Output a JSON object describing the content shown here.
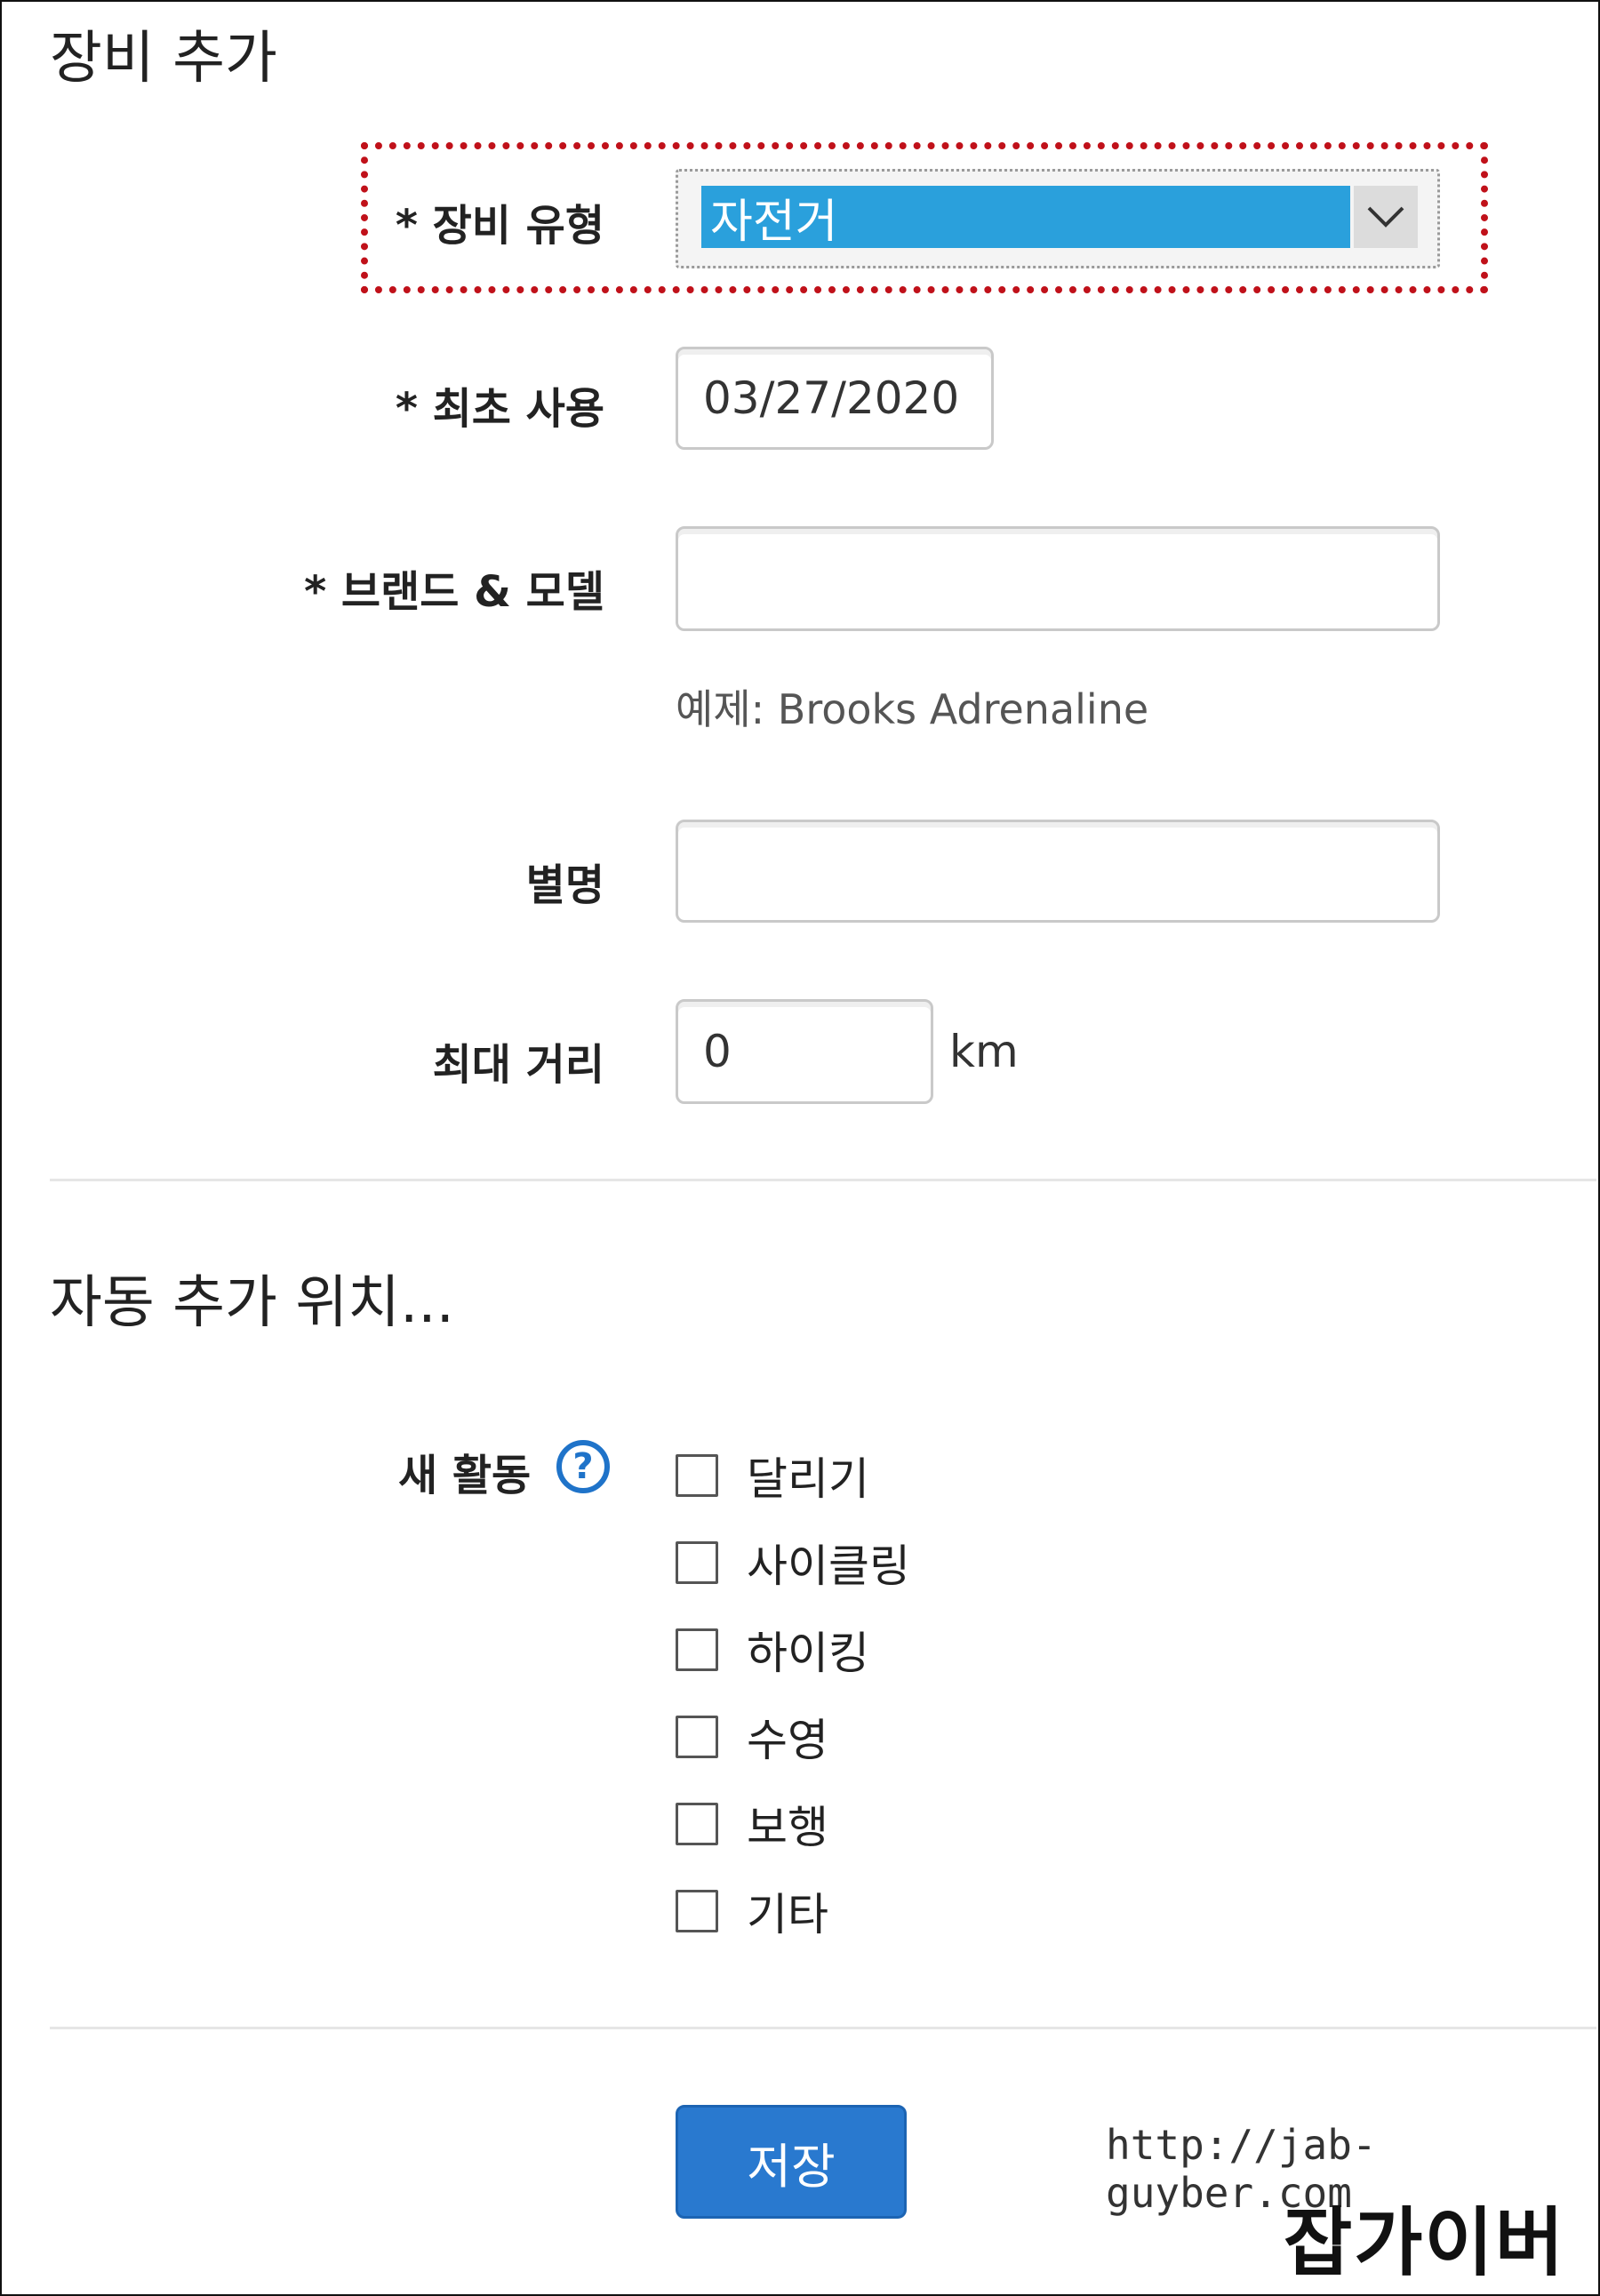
{
  "equipment": {
    "title": "장비 추가",
    "type_label": "* 장비 유형",
    "type_value": "자전거",
    "first_use_label": "* 최초 사용",
    "first_use_value": "03/27/2020",
    "brand_label": "* 브랜드 & 모델",
    "brand_value": "",
    "brand_hint": "예제: Brooks Adrenaline",
    "nickname_label": "별명",
    "nickname_value": "",
    "max_distance_label": "최대 거리",
    "max_distance_value": "0",
    "max_distance_unit": "km"
  },
  "auto_add": {
    "title": "자동 추가 위치...",
    "new_activity_label": "새 활동",
    "help_icon": "question-circle-icon",
    "options": [
      {
        "label": "달리기",
        "checked": false
      },
      {
        "label": "사이클링",
        "checked": false
      },
      {
        "label": "하이킹",
        "checked": false
      },
      {
        "label": "수영",
        "checked": false
      },
      {
        "label": "보행",
        "checked": false
      },
      {
        "label": "기타",
        "checked": false
      }
    ]
  },
  "actions": {
    "save_label": "저장"
  },
  "watermark": {
    "url": "http://jab-guyber.com",
    "logo": "잡가이버"
  },
  "colors": {
    "highlight": "#c0111a",
    "select_bg": "#2aa0dc",
    "button": "#2979cf",
    "help_icon": "#1f73c9"
  }
}
